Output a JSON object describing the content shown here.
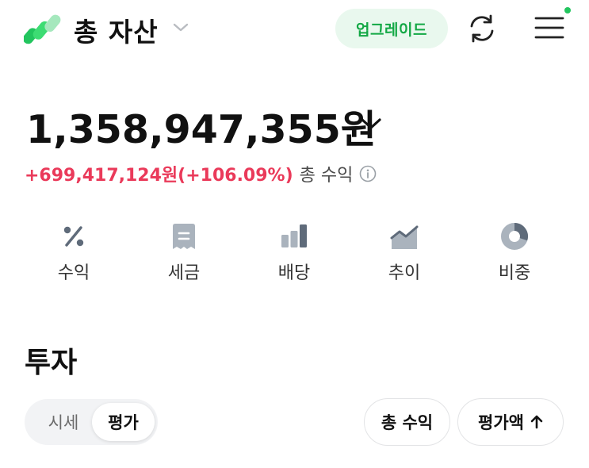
{
  "header": {
    "title": "총 자산",
    "upgrade_label": "업그레이드",
    "notification_dot": true,
    "brand_color": "#22c55e"
  },
  "summary": {
    "total_amount": "1,358,947,355원",
    "profit_value": "+699,417,124원(+106.09%)",
    "profit_label": "총 수익",
    "profit_color": "#ea3a5a"
  },
  "quick_menu": [
    {
      "label": "수익",
      "icon": "percent-icon"
    },
    {
      "label": "세금",
      "icon": "receipt-icon"
    },
    {
      "label": "배당",
      "icon": "bar-chart-icon"
    },
    {
      "label": "추이",
      "icon": "area-chart-icon"
    },
    {
      "label": "비중",
      "icon": "donut-chart-icon"
    }
  ],
  "investment": {
    "section_title": "투자",
    "segments": [
      "시세",
      "평가"
    ],
    "selected_segment": "평가",
    "filter_label": "총 수익",
    "sort_label": "평가액",
    "sort_direction": "ascending"
  }
}
